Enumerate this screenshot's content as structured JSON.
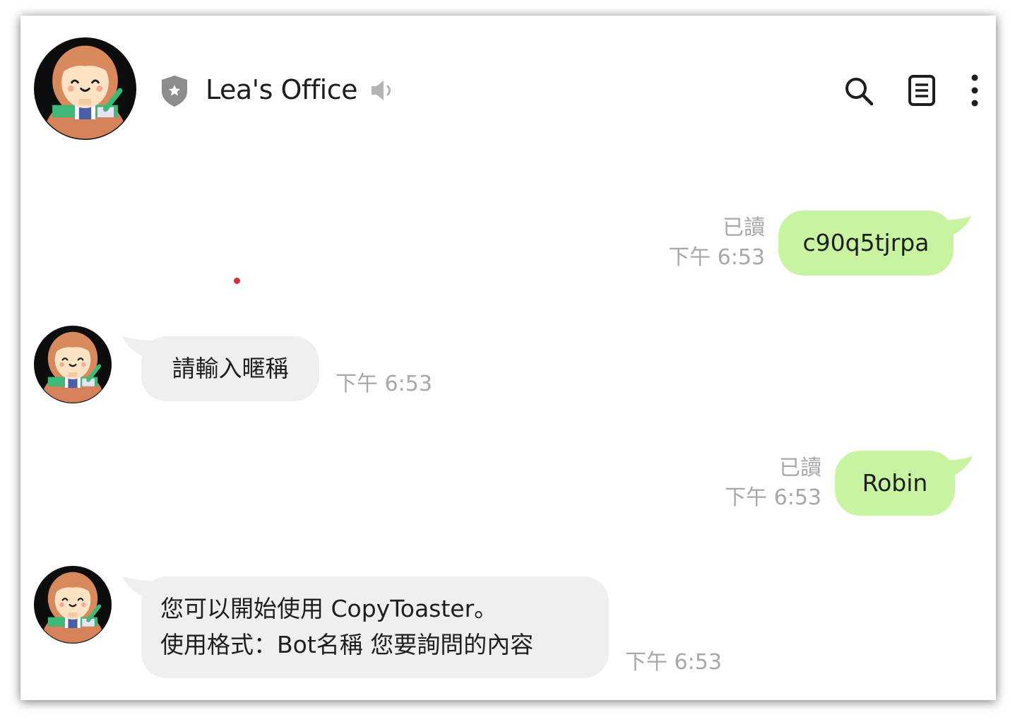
{
  "header": {
    "title": "Lea's Office",
    "icons": [
      "avatar",
      "shield-icon",
      "speaker-muted-icon",
      "search-icon",
      "notes-icon",
      "more-vertical-icon"
    ]
  },
  "messages": [
    {
      "direction": "out",
      "text": "c90q5tjrpa",
      "read": "已讀",
      "time": "下午 6:53"
    },
    {
      "direction": "in",
      "text": "請輸入暱稱",
      "time": "下午 6:53"
    },
    {
      "direction": "out",
      "text": "Robin",
      "read": "已讀",
      "time": "下午 6:53"
    },
    {
      "direction": "in",
      "lines": [
        "您可以開始使用 CopyToaster。",
        "使用格式：Bot名稱 您要詢問的內容"
      ],
      "time": "下午 6:53"
    }
  ],
  "colors": {
    "outgoing_bubble": "#c8f3a0",
    "incoming_bubble": "#efefef",
    "meta_text": "#a8a8a8",
    "title_text": "#1e1e1e"
  }
}
